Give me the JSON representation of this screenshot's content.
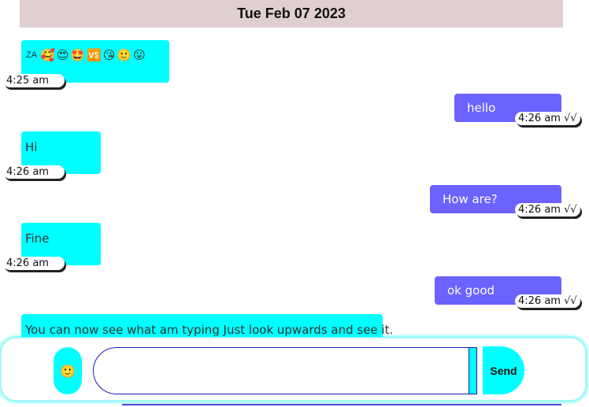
{
  "date_header": "Tue Feb 07 2023",
  "messages": [
    {
      "direction": "in",
      "prefix": "ZA",
      "emojis": [
        "🥰",
        "😍",
        "🤩",
        "🆚",
        "😘",
        "🙂",
        "😛"
      ],
      "time": "4:25 am"
    },
    {
      "direction": "out",
      "text": "hello",
      "time": "4:26 am √√"
    },
    {
      "direction": "in",
      "text": "Hi",
      "time": "4:26 am"
    },
    {
      "direction": "out",
      "text": "How are?",
      "time": "4:26 am √√"
    },
    {
      "direction": "in",
      "text": "Fine",
      "time": "4:26 am"
    },
    {
      "direction": "out",
      "text": "ok good",
      "time": "4:26 am √√"
    },
    {
      "direction": "in",
      "text": "You can now see what am typing Just look upwards and see it."
    }
  ],
  "composer": {
    "emoji_button_glyph": "🙂",
    "input_value": "",
    "send_label": "Send"
  },
  "colors": {
    "incoming": "#00ffff",
    "outgoing": "#6b62ff",
    "date_bar": "#e0cfd0"
  }
}
